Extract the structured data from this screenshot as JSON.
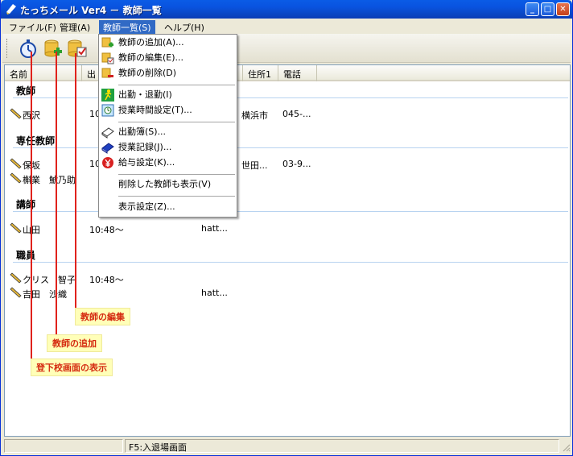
{
  "window": {
    "title": "たっちメール Ver4 － 教師一覧"
  },
  "menubar": [
    {
      "label": "ファイル(F)",
      "active": false
    },
    {
      "label": "管理(A)",
      "active": false
    },
    {
      "label": "教師一覧(S)",
      "active": true
    },
    {
      "label": "ヘルプ(H)",
      "active": false
    }
  ],
  "toolbar": {
    "buttons": [
      {
        "name": "stopwatch-icon"
      },
      {
        "name": "add-teacher-icon"
      },
      {
        "name": "edit-teacher-icon"
      }
    ]
  },
  "columns": [
    "名前",
    "出",
    "",
    "住所1",
    "電話"
  ],
  "groups": [
    {
      "title": "教師",
      "rows": [
        {
          "name": "西沢",
          "time": "10",
          "address": "横浜市",
          "phone": "045-..."
        }
      ]
    },
    {
      "title": "専任教師",
      "rows": [
        {
          "name": "保坂",
          "time": "10",
          "address": "世田...",
          "phone": "03-9..."
        },
        {
          "name": "槲業　鯱乃助",
          "time": "",
          "address": "",
          "phone": ""
        }
      ]
    },
    {
      "title": "講師",
      "rows": [
        {
          "name": "山田",
          "time": "10:48～",
          "mail": "hatt..."
        }
      ]
    },
    {
      "title": "職員",
      "rows": [
        {
          "name": "クリス　智子",
          "time": "10:48～",
          "mail": ""
        },
        {
          "name": "吉田　沙織",
          "time": "",
          "mail": "hatt..."
        }
      ]
    }
  ],
  "dropdown": {
    "items": [
      {
        "label": "教師の追加(A)...",
        "icon": "add-teacher-icon"
      },
      {
        "label": "教師の編集(E)...",
        "icon": "edit-teacher-icon"
      },
      {
        "label": "教師の削除(D)",
        "icon": "delete-teacher-icon"
      },
      {
        "label": "出勤・退勤(I)",
        "icon": "running-person-icon"
      },
      {
        "label": "授業時間設定(T)...",
        "icon": "class-time-icon"
      },
      {
        "label": "出勤簿(S)...",
        "icon": "attendance-book-icon"
      },
      {
        "label": "授業記録(J)...",
        "icon": "class-record-icon"
      },
      {
        "label": "給与設定(K)...",
        "icon": "salary-yen-icon"
      },
      {
        "label": "削除した教師も表示(V)",
        "icon": ""
      },
      {
        "label": "表示設定(Z)...",
        "icon": ""
      }
    ]
  },
  "callouts": {
    "edit": "教師の編集",
    "add": "教師の追加",
    "login": "登下校画面の表示"
  },
  "statusbar": {
    "pane1": "",
    "pane2": "F5:入退場画面"
  },
  "colors": {
    "titlebar": "#0a5ce6",
    "menu_active": "#316ac5",
    "callout_line": "#e0221c",
    "callout_bg": "#ffffb8"
  }
}
